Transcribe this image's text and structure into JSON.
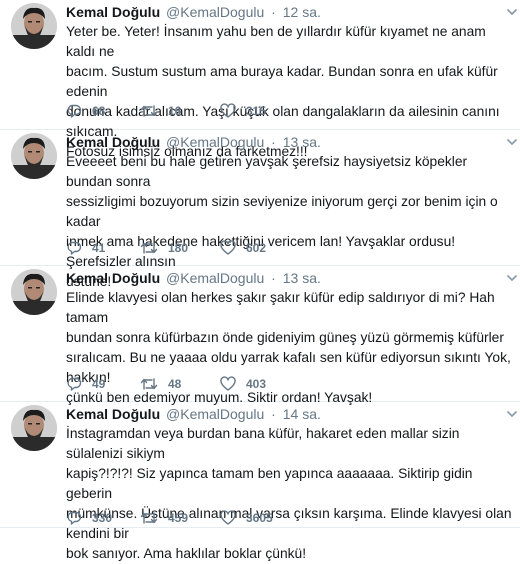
{
  "tweets": [
    {
      "name": "Kemal Doğulu",
      "handle": "@KemalDogulu",
      "time": "12 sa.",
      "text": "Yeter be. Yeter! İnsanım yahu ben de yıllardır küfür kıyamet ne anam kaldı ne\nbacım. Sustum sustum ama buraya kadar. Bundan sonra en ufak küfür edenin\ndonuna kadar alıcam. Yaşı küçük olan dangalakların da ailesinin canını sıkıcam.\nFotosuz isimsiz olmanız da farketmez!!!",
      "replies": "68",
      "retweets": "16",
      "likes": "315"
    },
    {
      "name": "Kemal Doğulu",
      "handle": "@KemalDogulu",
      "time": "13 sa.",
      "text": "Eveeeet beni bu hale getiren yavşak şerefsiz haysiyetsiz köpekler bundan sonra\nsessizligimi bozuyorum sizin seviyenize iniyorum gerçi zor benim için o kadar\ninmek ama hakedene hakettiğini vericem lan! Yavşaklar ordusu! Şerefsizler alınsın\nüstüne!",
      "replies": "41",
      "retweets": "180",
      "likes": "602"
    },
    {
      "name": "Kemal Doğulu",
      "handle": "@KemalDogulu",
      "time": "13 sa.",
      "text": "Elinde klavyesi olan herkes şakır şakır küfür edip saldırıyor di mi? Hah tamam\nbundan sonra küfürbazın önde gideniyim güneş yüzü görmemiş küfürler\nsıralıcam. Bu ne yaaaa oldu yarrak kafalı sen küfür ediyorsun sıkıntı Yok, hakkın!\nçünkü ben edemiyor muyum. Siktir ordan! Yavşak!",
      "replies": "49",
      "retweets": "48",
      "likes": "403"
    },
    {
      "name": "Kemal Doğulu",
      "handle": "@KemalDogulu",
      "time": "14 sa.",
      "text": "İnstagramdan veya burdan bana küfür, hakaret eden mallar sizin sülalenizi sikiym\nkapiş?!?!?! Siz yapınca tamam ben yapınca aaaaaaa. Siktirip gidin geberin\nmümkünse. Üstüne alınan mal varsa çıksın karşıma. Elinde klavyesi olan kendini bir\nbok sanıyor. Ama haklılar boklar çünkü!",
      "replies": "330",
      "retweets": "459",
      "likes": "3605"
    }
  ],
  "icons": {
    "reply": "reply-icon",
    "retweet": "retweet-icon",
    "like": "heart-icon",
    "menu": "chevron-down-icon"
  },
  "colors": {
    "text": "#14171a",
    "secondary": "#657786",
    "divider": "#e6ecf0"
  }
}
